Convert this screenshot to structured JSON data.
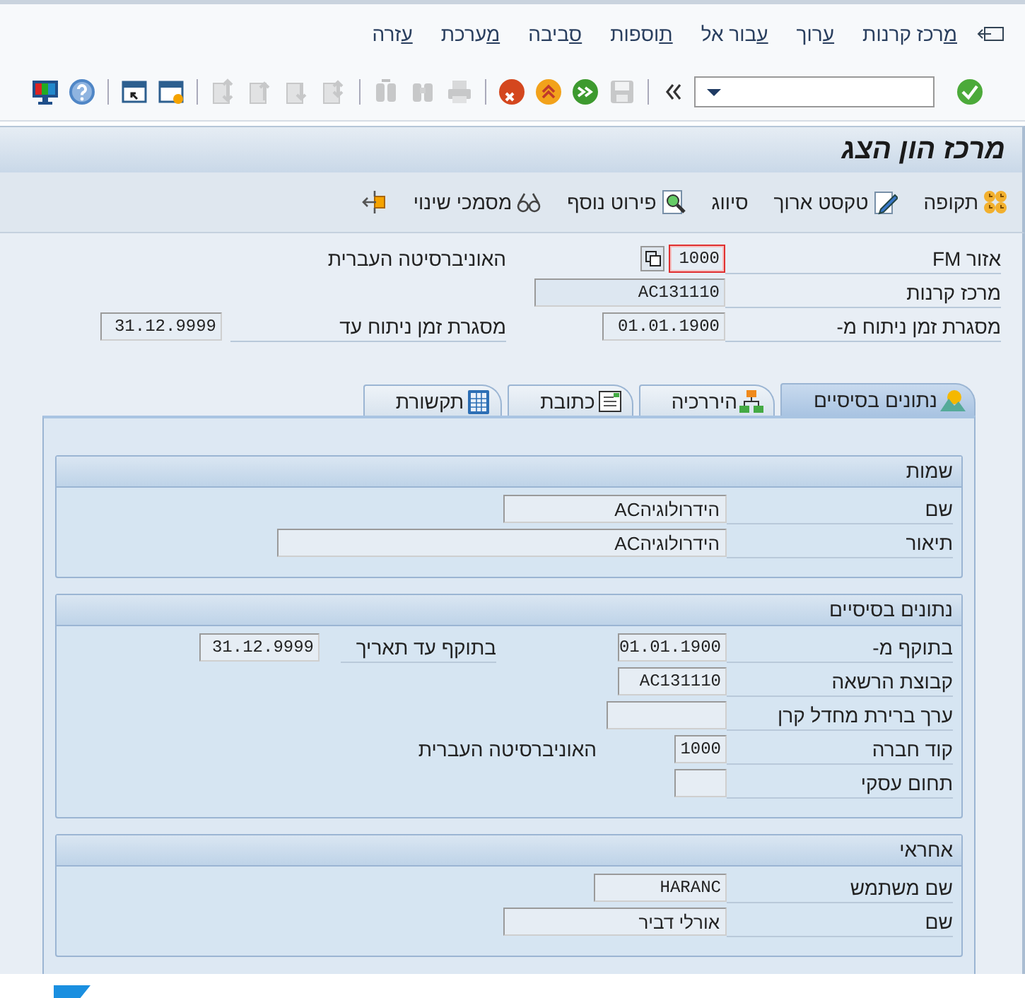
{
  "menu_bar": [
    "מרכז קרנות",
    "ערוך",
    "עבור אל",
    "תוספות",
    "סביבה",
    "מערכת",
    "עזרה"
  ],
  "system_toolbar": [
    {
      "disabled": false
    },
    {
      "disabled": true
    },
    {
      "disabled": false
    },
    {
      "disabled": false
    },
    {
      "disabled": false
    },
    {
      "disabled": true
    },
    {
      "disabled": true
    },
    {
      "disabled": true
    },
    {
      "disabled": true
    },
    {
      "disabled": true
    },
    {
      "disabled": true
    },
    {
      "disabled": true
    },
    {
      "disabled": false
    },
    {
      "disabled": false
    },
    {
      "disabled": false
    },
    {
      "disabled": false
    }
  ],
  "title": "מרכז הון הצג",
  "app_toolbar": [
    {
      "label": "תקופה"
    },
    {
      "label": "טקסט ארוך"
    },
    {
      "label": "סיווג"
    },
    {
      "label": "פירוט נוסף"
    },
    {
      "label": "מסמכי שינוי"
    }
  ],
  "header": {
    "rows": [
      {
        "label": "אזור FM",
        "value": "1000",
        "description": "האוניברסיטה העברית",
        "focused": true
      },
      {
        "label": "מרכז קרנות",
        "value": "AC131110",
        "focused": false
      },
      {
        "label": "מסגרת זמן ניתוח מ-",
        "value": "01.01.1900",
        "label_2": "מסגרת זמן ניתוח עד",
        "value_2": "31.12.9999",
        "focused": false
      }
    ]
  },
  "tabs": [
    {
      "label": "נתונים בסיסיים",
      "selected": true
    },
    {
      "label": "היררכיה",
      "selected": false
    },
    {
      "label": "כתובת",
      "selected": false
    },
    {
      "label": "תקשורת",
      "selected": false
    }
  ],
  "groups": [
    {
      "title": "שמות",
      "rows": [
        {
          "label": "שם",
          "value": "הידרולוגיהAC"
        },
        {
          "label": "תיאור",
          "value": "הידרולוגיהAC"
        }
      ]
    },
    {
      "title": "נתונים בסיסיים",
      "rows": [
        {
          "label": "בתוקף מ-",
          "value": "01.01.1900",
          "label_2": "בתוקף עד תאריך",
          "value_2": "31.12.9999"
        },
        {
          "label": "קבוצת הרשאה",
          "value": "AC131110"
        },
        {
          "label": "ערך ברירת מחדל קרן"
        },
        {
          "label": "קוד חברה",
          "value": "1000",
          "description": "האוניברסיטה העברית"
        },
        {
          "label": "תחום עסקי"
        }
      ]
    },
    {
      "title": "אחראי",
      "rows": [
        {
          "label": "שם משתמש",
          "value": "HARANC"
        },
        {
          "label": "שם",
          "value": "אורלי דביר"
        }
      ]
    }
  ]
}
